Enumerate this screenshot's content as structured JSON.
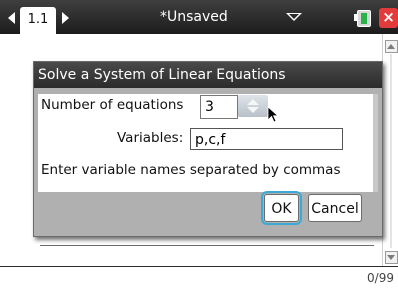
{
  "topbar": {
    "tab_label": "1.1",
    "doc_title": "*Unsaved",
    "icons": [
      "left-arrow-icon",
      "right-arrow-icon",
      "chevron-down-icon",
      "battery-icon",
      "close-icon"
    ]
  },
  "dialog": {
    "title": "Solve a System of Linear Equations",
    "num_equations_label": "Number of equations",
    "num_equations_value": "3",
    "variables_label": "Variables:",
    "variables_value": "p,c,f",
    "hint": "Enter variable names separated by commas",
    "ok_label": "OK",
    "cancel_label": "Cancel"
  },
  "entry": {
    "char_count": "0/99"
  },
  "colors": {
    "header_dark": "#2b2b2b",
    "dialog_bg": "#b0b0b0",
    "focus_ring": "#3aa9d8",
    "close_red": "#e23b3b",
    "battery_green": "#29b34a"
  }
}
